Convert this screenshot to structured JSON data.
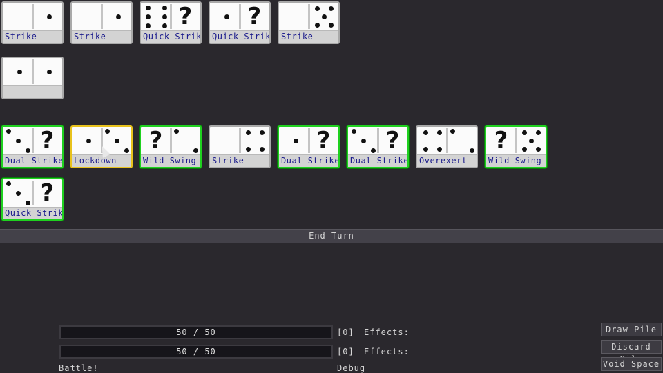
{
  "cards": [
    {
      "label": "Strike",
      "left": [],
      "right": [
        1
      ],
      "state": "normal"
    },
    {
      "label": "Strike",
      "left": [],
      "right": [
        1
      ],
      "state": "normal"
    },
    {
      "label": "Quick Strike",
      "left": [
        6
      ],
      "right": [
        "?"
      ],
      "state": "normal"
    },
    {
      "label": "Quick Strike",
      "left": [
        1
      ],
      "right": [
        "?"
      ],
      "state": "normal"
    },
    {
      "label": "Strike",
      "left": [],
      "right": [
        5
      ],
      "state": "normal"
    },
    {
      "label": "",
      "left": [
        1
      ],
      "right": [
        1
      ],
      "state": "normal"
    },
    {
      "label": "Dual Strike",
      "left": [
        3
      ],
      "right": [
        "?"
      ],
      "state": "playable"
    },
    {
      "label": "Lockdown",
      "left": [
        1
      ],
      "right": [
        3
      ],
      "state": "selected"
    },
    {
      "label": "Wild Swing",
      "left": [
        "?"
      ],
      "right": [
        2
      ],
      "state": "playable"
    },
    {
      "label": "Strike",
      "left": [],
      "right": [
        4
      ],
      "state": "normal"
    },
    {
      "label": "Dual Strike",
      "left": [
        1
      ],
      "right": [
        "?"
      ],
      "state": "playable"
    },
    {
      "label": "Dual Strike",
      "left": [
        3
      ],
      "right": [
        "?"
      ],
      "state": "playable"
    },
    {
      "label": "Overexert",
      "left": [
        4
      ],
      "right": [
        2
      ],
      "state": "normal"
    },
    {
      "label": "Wild Swing",
      "left": [
        "?"
      ],
      "right": [
        5
      ],
      "state": "playable"
    },
    {
      "label": "Quick Strike",
      "left": [
        3
      ],
      "right": [
        "?"
      ],
      "state": "playable"
    }
  ],
  "end_turn_label": "End Turn",
  "player": {
    "hp_text": "50 / 50",
    "block_text": "[0]",
    "effects_label": "Effects:"
  },
  "enemy": {
    "hp_text": "50 / 50",
    "block_text": "[0]",
    "effects_label": "Effects:"
  },
  "status_text": "Battle!",
  "debug_label": "Debug",
  "piles": {
    "draw": "Draw Pile",
    "discard": "Discard Pile",
    "void": "Void Space"
  }
}
